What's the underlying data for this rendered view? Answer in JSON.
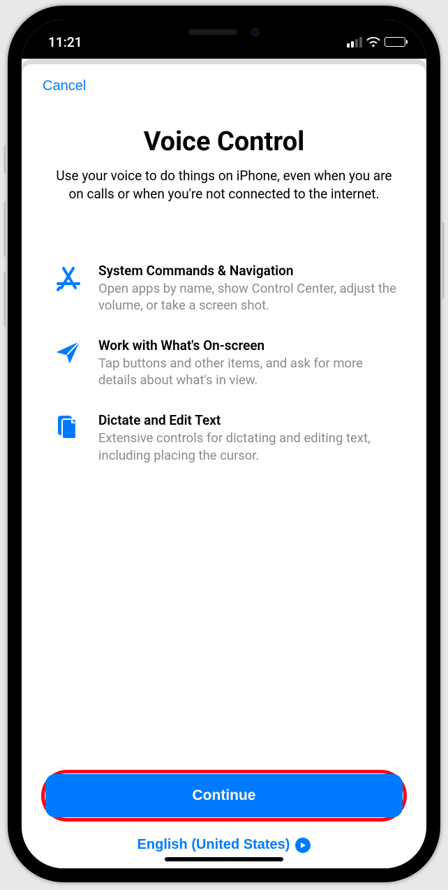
{
  "status_bar": {
    "time": "11:21"
  },
  "nav": {
    "cancel_label": "Cancel"
  },
  "header": {
    "title": "Voice Control",
    "subtitle": "Use your voice to do things on iPhone, even when you are on calls or when you're not connected to the internet."
  },
  "features": [
    {
      "title": "System Commands & Navigation",
      "desc": "Open apps by name, show Control Center, adjust the volume, or take a screen shot."
    },
    {
      "title": "Work with What's On-screen",
      "desc": "Tap buttons and other items, and ask for more details about what's in view."
    },
    {
      "title": "Dictate and Edit Text",
      "desc": "Extensive controls for dictating and editing text, including placing the cursor."
    }
  ],
  "actions": {
    "continue_label": "Continue",
    "language_label": "English (United States)"
  },
  "colors": {
    "accent": "#007aff",
    "highlight_ring": "#ff0016"
  }
}
